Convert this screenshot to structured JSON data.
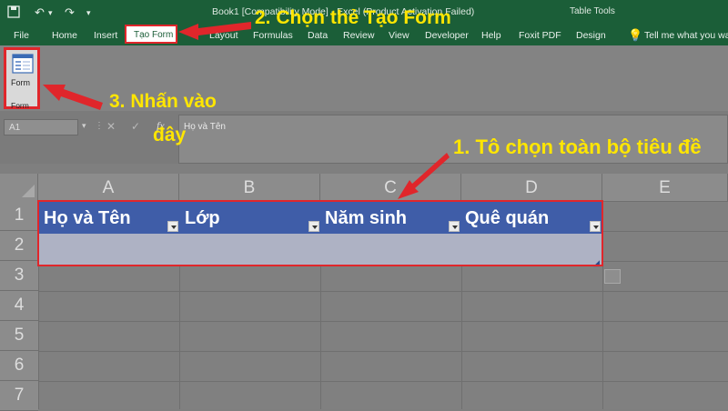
{
  "window": {
    "title": "Book1  [Compatibility Mode]  -  Excel (Product Activation Failed)",
    "context_tab": "Table Tools",
    "search_hint": "Tell me what you want"
  },
  "ribbon": {
    "tabs": [
      "File",
      "Home",
      "Insert",
      "Tạo Form",
      "Layout",
      "Formulas",
      "Data",
      "Review",
      "View",
      "Developer",
      "Help",
      "Foxit PDF",
      "Design"
    ],
    "form_button_label": "Form",
    "form_group_label": "Form"
  },
  "formula_bar": {
    "name_box": "A1",
    "fx": "fx",
    "content": "Họ và Tên"
  },
  "sheet": {
    "columns": [
      "A",
      "B",
      "C",
      "D",
      "E"
    ],
    "rows": [
      "1",
      "2",
      "3",
      "4",
      "5",
      "6",
      "7"
    ],
    "table_headers": [
      "Họ và Tên",
      "Lớp",
      "Năm sinh",
      "Quê quán"
    ]
  },
  "annotations": {
    "step1": "1. Tô chọn toàn bộ tiêu đề",
    "step2": "2. Chọn thẻ Tạo Form",
    "step3_line1": "3. Nhấn vào",
    "step3_line2": "đây"
  },
  "colors": {
    "accent": "#e0262b",
    "annotation_text": "#ffe600",
    "table_header": "#3f5da8",
    "excel_green": "#1b5e38"
  }
}
